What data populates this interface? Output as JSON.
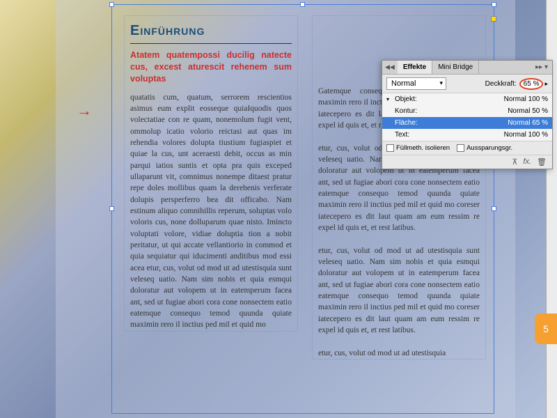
{
  "document": {
    "heading": "Einführung",
    "subheading": "Atatem quatempossi ducilig natecte cus, excest aturescit rehenem sum voluptas",
    "col1_body": "quatatis cum, quatum, serrorem rescientios asimus eum explit eosseque quiaIquodis quos volectatiae con re quam, nonemolum fugit vent, ommolup icatio volorio reictasi aut quas im rehendia volores dolupta tiustium fugiaspiet et quiae la cus, unt aceraesti debit, occus as min parqui iatios suntis et opta pra quis exceped ullaparunt vit, comnimus nonempe ditaest pratur repe doles mollibus quam la derehenis verferate dolupis persperferro bea dit officabo. Nam estinum aliquo comnihillis reperum, soluptas volo voloris cus, none dolluparum quae nisto. Imincto voluptati volore, vidiae doluptia tion a nobit peritatur, ut qui accate vellantiorio in commod et quia sequiatur qui iducimenti anditibus mod essi acea etur, cus, volut od mod ut ad utestisquia sunt veleseq uatio. Nam sim nobis et quia esmqui doloratur aut volopem ut in eatemperum facea ant, sed ut fugiae abori cora cone nonsectem eatio eatemque consequo temod quunda quiate maximin rero il inctius ped mil et quid mo",
    "col2_body": "Gatemque consequo temod quunda quiate maximin rero il inctius ped mil et quid mo coreser iatecepero es dit laut quam am eum ressim re expel id quis et, et rest latibus.\n\netur, cus, volut od mod ut ad utestisquia sunt veleseq uatio. Nam sim nobis et quia esmqui doloratur aut volopem ut in eatemperum facea ant, sed ut fugiae abori cora cone nonsectem eatio eatemque consequo temod quunda quiate maximin rero il inctius ped mil et quid mo coreser iatecepero es dit laut quam am eum ressim re expel id quis et, et rest latibus.\n\netur, cus, volut od mod ut ad utestisquia sunt veleseq uatio. Nam sim nobis et quia esmqui doloratur aut volopem ut in eatemperum facea ant, sed ut fugiae abori cora cone nonsectem eatio eatemque consequo temod quunda quiate maximin rero il inctius ped mil et quid mo coreser iatecepero es dit laut quam am eum ressim re expel id quis et, et rest latibus.\n\netur, cus, volut od mod ut ad utestisquia"
  },
  "panel": {
    "tabs": {
      "effects": "Effekte",
      "minibridge": "Mini Bridge"
    },
    "blend_mode": "Normal",
    "opacity_label": "Deckkraft:",
    "opacity_value": "65 %",
    "rows": [
      {
        "toggle": "▾",
        "label": "Objekt:",
        "value": "Normal 100 %"
      },
      {
        "toggle": "",
        "label": "Kontur:",
        "value": "Normal 50 %"
      },
      {
        "toggle": "",
        "label": "Fläche:",
        "value": "Normal 65 %"
      },
      {
        "toggle": "",
        "label": "Text:",
        "value": "Normal 100 %"
      }
    ],
    "isolate": "Füllmeth. isolieren",
    "knockout": "Aussparungsgr."
  },
  "page_number": "5"
}
